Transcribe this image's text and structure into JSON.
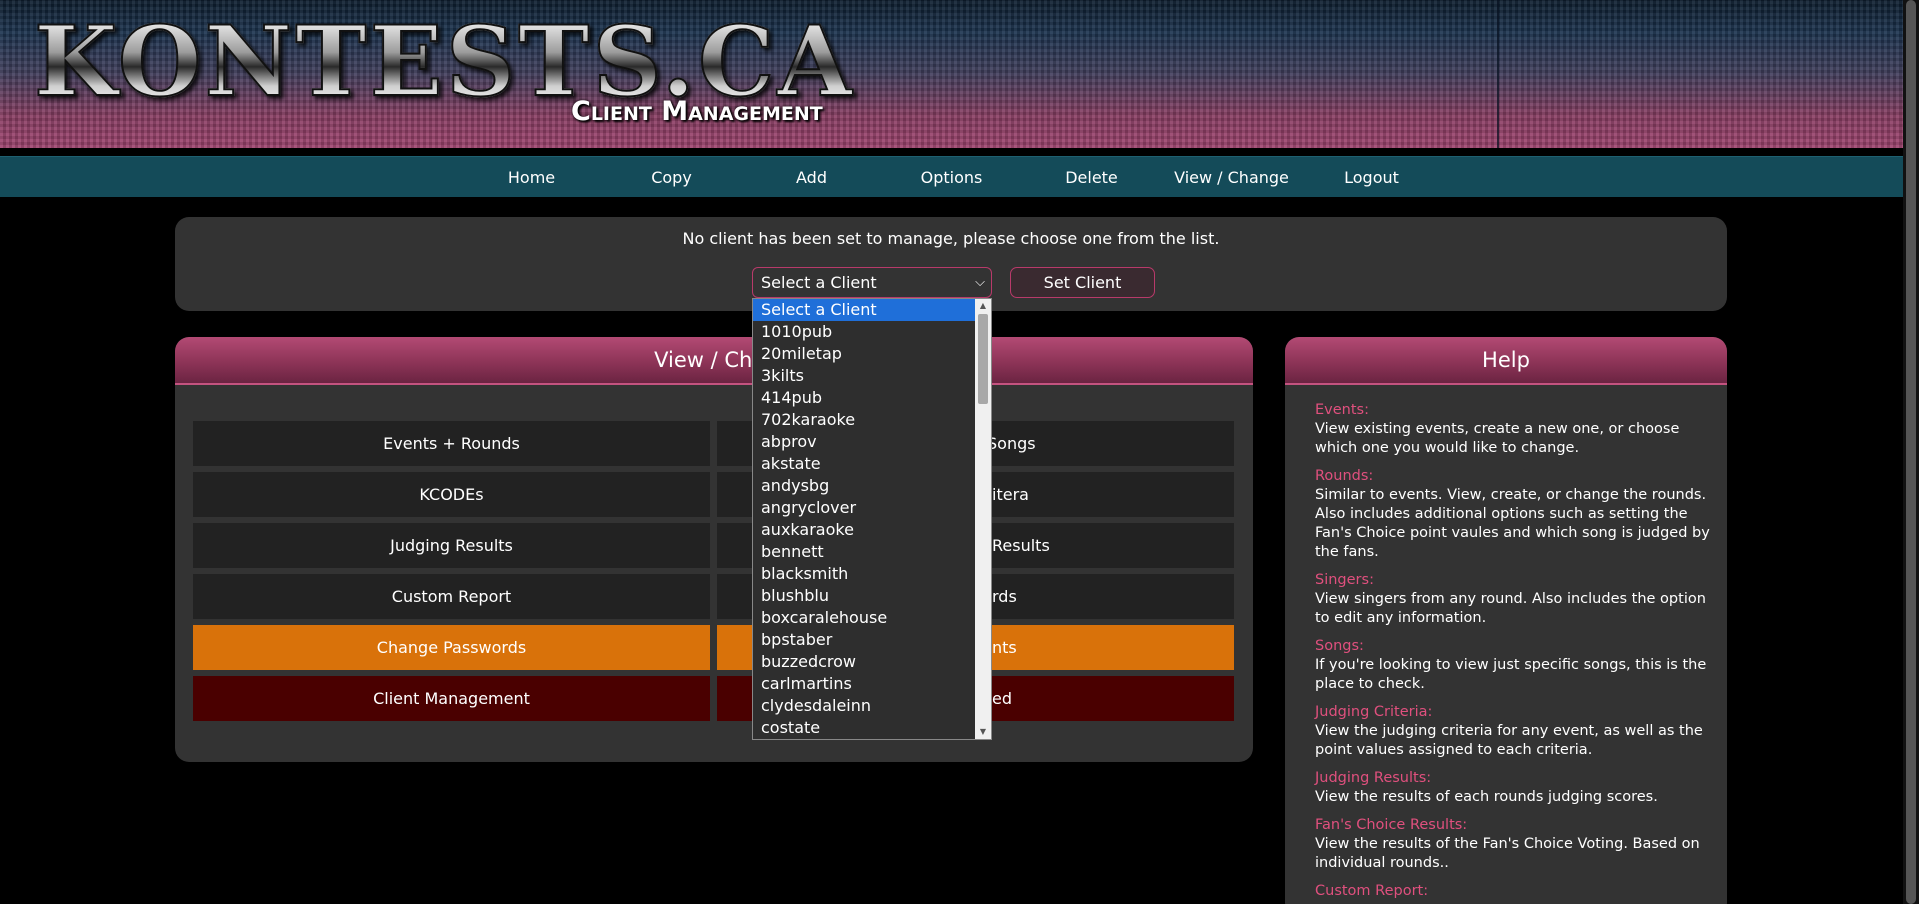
{
  "header": {
    "logo_text": "KONTESTS.CA",
    "subtitle": "Client Management"
  },
  "nav": {
    "items": [
      "Home",
      "Copy",
      "Add",
      "Options",
      "Delete",
      "View / Change",
      "Logout"
    ]
  },
  "client": {
    "message": "No client has been set to manage, please choose one from the list.",
    "select_value": "Select a Client",
    "set_button": "Set Client",
    "options": [
      "Select a Client",
      "1010pub",
      "20miletap",
      "3kilts",
      "414pub",
      "702karaoke",
      "abprov",
      "akstate",
      "andysbg",
      "angryclover",
      "auxkaraoke",
      "bennett",
      "blacksmith",
      "blushblu",
      "boxcaralehouse",
      "bpstaber",
      "buzzedcrow",
      "carlmartins",
      "clydesdaleinn",
      "costate"
    ]
  },
  "main_panel": {
    "title_visible": "View / Char",
    "buttons_left": [
      "Events + Rounds",
      "KCODEs",
      "Judging Results",
      "Custom Report",
      "Change Passwords",
      "Client Management"
    ],
    "buttons_right_visible": [
      "Songs",
      "itera",
      "Results",
      "rds",
      "nts",
      "ed"
    ]
  },
  "help": {
    "title": "Help",
    "items": [
      {
        "title": "Events:",
        "desc": "View existing events, create a new one, or choose which one you would like to change."
      },
      {
        "title": "Rounds:",
        "desc": "Similar to events. View, create, or change the rounds. Also includes additional options such as setting the Fan's Choice point vaules and which song is judged by the fans."
      },
      {
        "title": "Singers:",
        "desc": "View singers from any round. Also includes the option to edit any information."
      },
      {
        "title": "Songs:",
        "desc": "If you're looking to view just specific songs, this is the place to check."
      },
      {
        "title": "Judging Criteria:",
        "desc": "View the judging criteria for any event, as well as the point values assigned to each criteria."
      },
      {
        "title": "Judging Results:",
        "desc": "View the results of each rounds judging scores."
      },
      {
        "title": "Fan's Choice Results:",
        "desc": "View the results of the Fan's Choice Voting. Based on individual rounds.."
      },
      {
        "title": "Custom Report:",
        "desc": ""
      }
    ]
  },
  "colors": {
    "nav_bg": "#144b59",
    "accent_pink": "#e0507e",
    "orange": "#d9720a",
    "maroon": "#4a0000",
    "panel": "#333333"
  }
}
